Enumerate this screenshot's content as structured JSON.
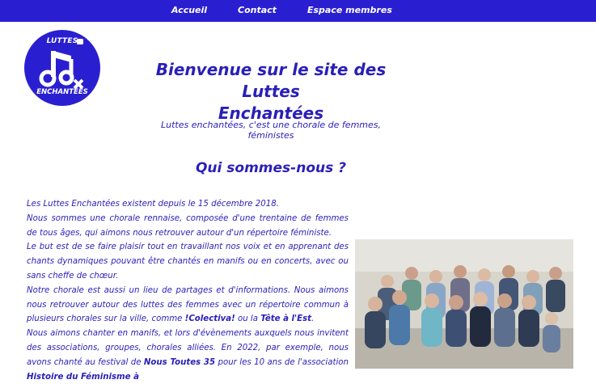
{
  "nav": {
    "items": [
      "Accueil",
      "Contact",
      "Espace membres"
    ]
  },
  "logo": {
    "top": "LUTTES",
    "bottom": "ENCHANTÉES"
  },
  "header": {
    "title_line1": "Bienvenue sur le site des Luttes",
    "title_line2": "Enchantées",
    "subtitle": "Luttes enchantées, c'est une chorale de femmes, féministes"
  },
  "section": {
    "heading": "Qui sommes-nous ?",
    "p1": "Les Luttes Enchantées existent depuis le 15 décembre 2018.",
    "p2": "Nous sommes une chorale rennaise, composée d'une trentaine de femmes de tous âges, qui aimons nous retrouver autour d'un répertoire féministe.",
    "p3": "Le but est de se faire plaisir tout en travaillant nos voix et en apprenant des chants dynamiques pouvant être chantés en manifs ou en concerts, avec ou sans cheffe de chœur.",
    "p4a": "Notre chorale est aussi un lieu de partages et d'informations. Nous aimons nous retrouver autour des luttes des femmes avec un répertoire commun à plusieurs chorales sur la ville, comme ",
    "p4b": "!Colectiva!",
    "p4c": " ou la ",
    "p4d": "Tête à l'Est",
    "p4e": ".",
    "p5a": "Nous aimons chanter en manifs, et lors d'évènements auxquels nous invitent des associations, groupes, chorales alliées. En 2022, par exemple, nous avons chanté au festival de ",
    "p5b": "Nous Toutes 35",
    "p5c": " pour les 10 ans de l'association ",
    "p5d": "Histoire du Féminisme à"
  },
  "colors": {
    "accent": "#2a1fd0",
    "text": "#2a1fb8"
  }
}
